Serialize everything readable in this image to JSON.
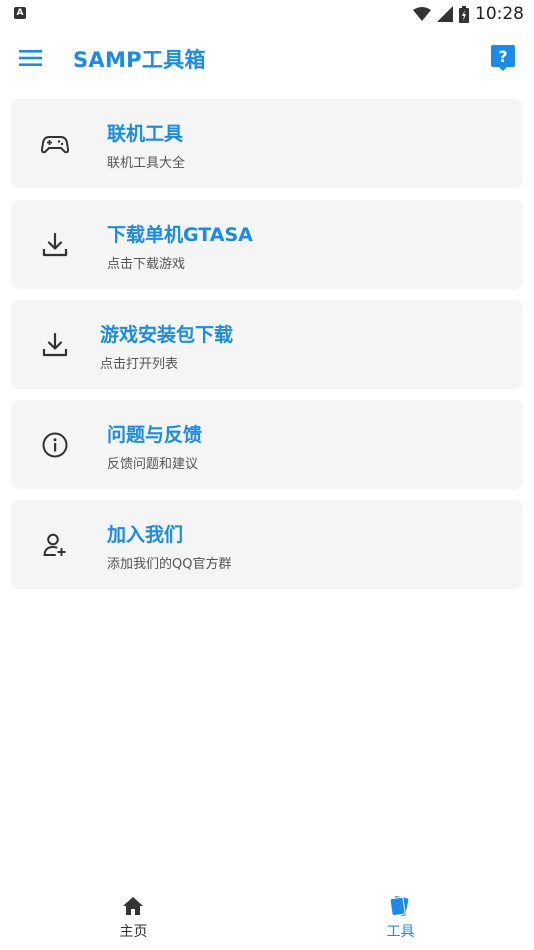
{
  "status_bar": {
    "time": "10:28",
    "notification_letter": "A"
  },
  "app_bar": {
    "title": "SAMP工具箱"
  },
  "cards": [
    {
      "title": "联机工具",
      "subtitle": "联机工具大全",
      "icon": "gamepad-icon"
    },
    {
      "title": "下载单机GTASA",
      "subtitle": "点击下载游戏",
      "icon": "download-icon"
    },
    {
      "title": "游戏安装包下载",
      "subtitle": "点击打开列表",
      "icon": "download-icon"
    },
    {
      "title": "问题与反馈",
      "subtitle": "反馈问题和建议",
      "icon": "info-icon"
    },
    {
      "title": "加入我们",
      "subtitle": "添加我们的QQ官方群",
      "icon": "person-add-icon"
    }
  ],
  "bottom_nav": {
    "items": [
      {
        "label": "主页",
        "icon": "home-icon",
        "active": false
      },
      {
        "label": "工具",
        "icon": "tools-icon",
        "active": true
      }
    ]
  },
  "colors": {
    "accent": "#1a8bea",
    "card_bg": "#f5f5f5",
    "text_secondary": "#555555",
    "nav_inactive": "#333333"
  }
}
